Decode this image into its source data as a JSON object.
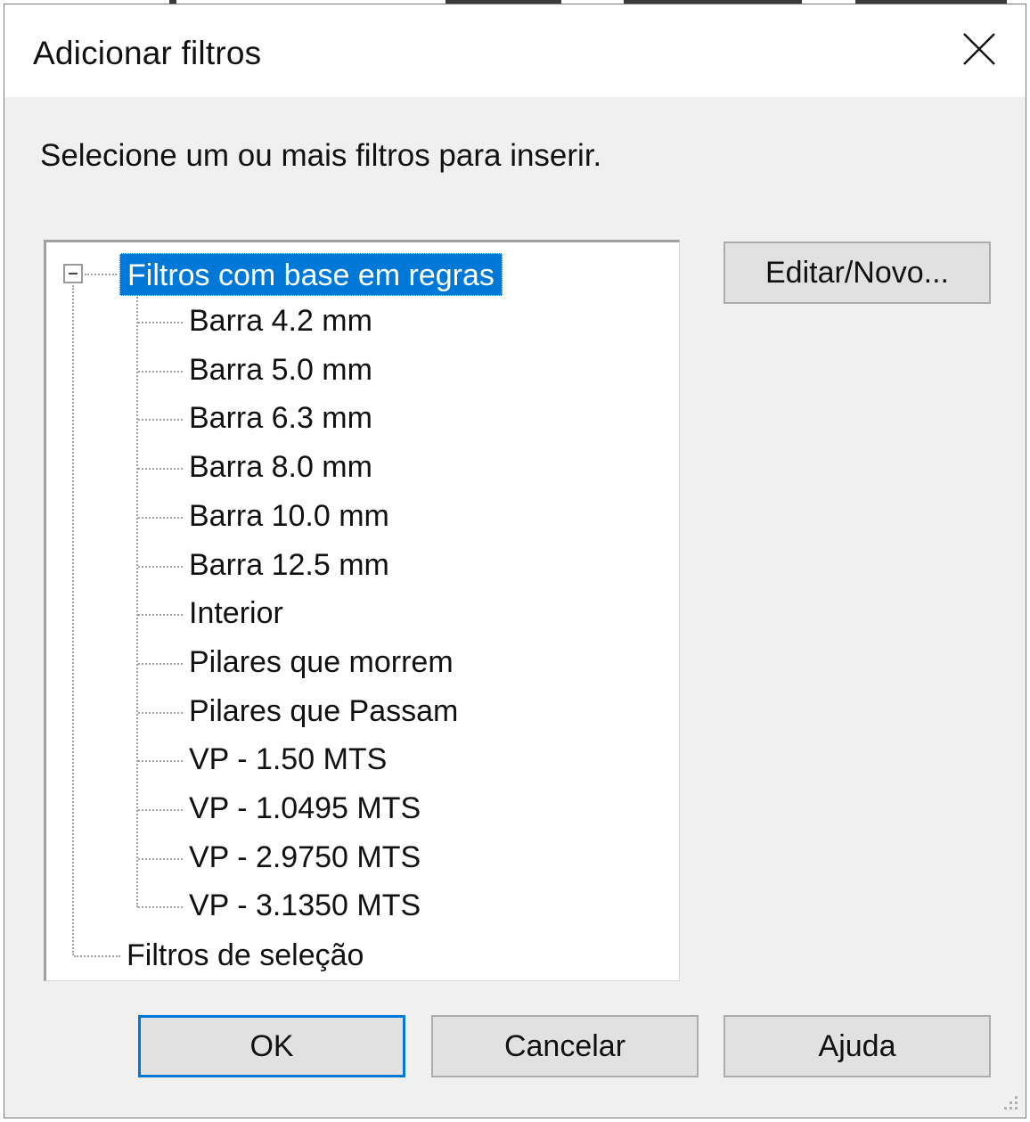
{
  "dialog": {
    "title": "Adicionar filtros",
    "close_icon": "close-icon",
    "instructions": "Selecione um ou mais filtros para inserir."
  },
  "tree": {
    "root": {
      "label": "Filtros com base em regras",
      "expanded": true,
      "selected": true,
      "children": [
        "Barra 4.2 mm",
        "Barra 5.0 mm",
        "Barra 6.3 mm",
        "Barra 8.0 mm",
        "Barra 10.0 mm",
        "Barra 12.5 mm",
        "Interior",
        "Pilares que morrem",
        "Pilares que Passam",
        "VP - 1.50 MTS",
        "VP - 1.0495 MTS",
        "VP - 2.9750 MTS",
        "VP - 3.1350 MTS"
      ]
    },
    "root2": {
      "label": "Filtros de seleção"
    }
  },
  "buttons": {
    "edit_new": "Editar/Novo...",
    "ok": "OK",
    "cancel": "Cancelar",
    "help": "Ajuda"
  },
  "colors": {
    "selection": "#0078d7",
    "dialog_bg": "#f0f0f0",
    "button_bg": "#e1e1e1"
  }
}
